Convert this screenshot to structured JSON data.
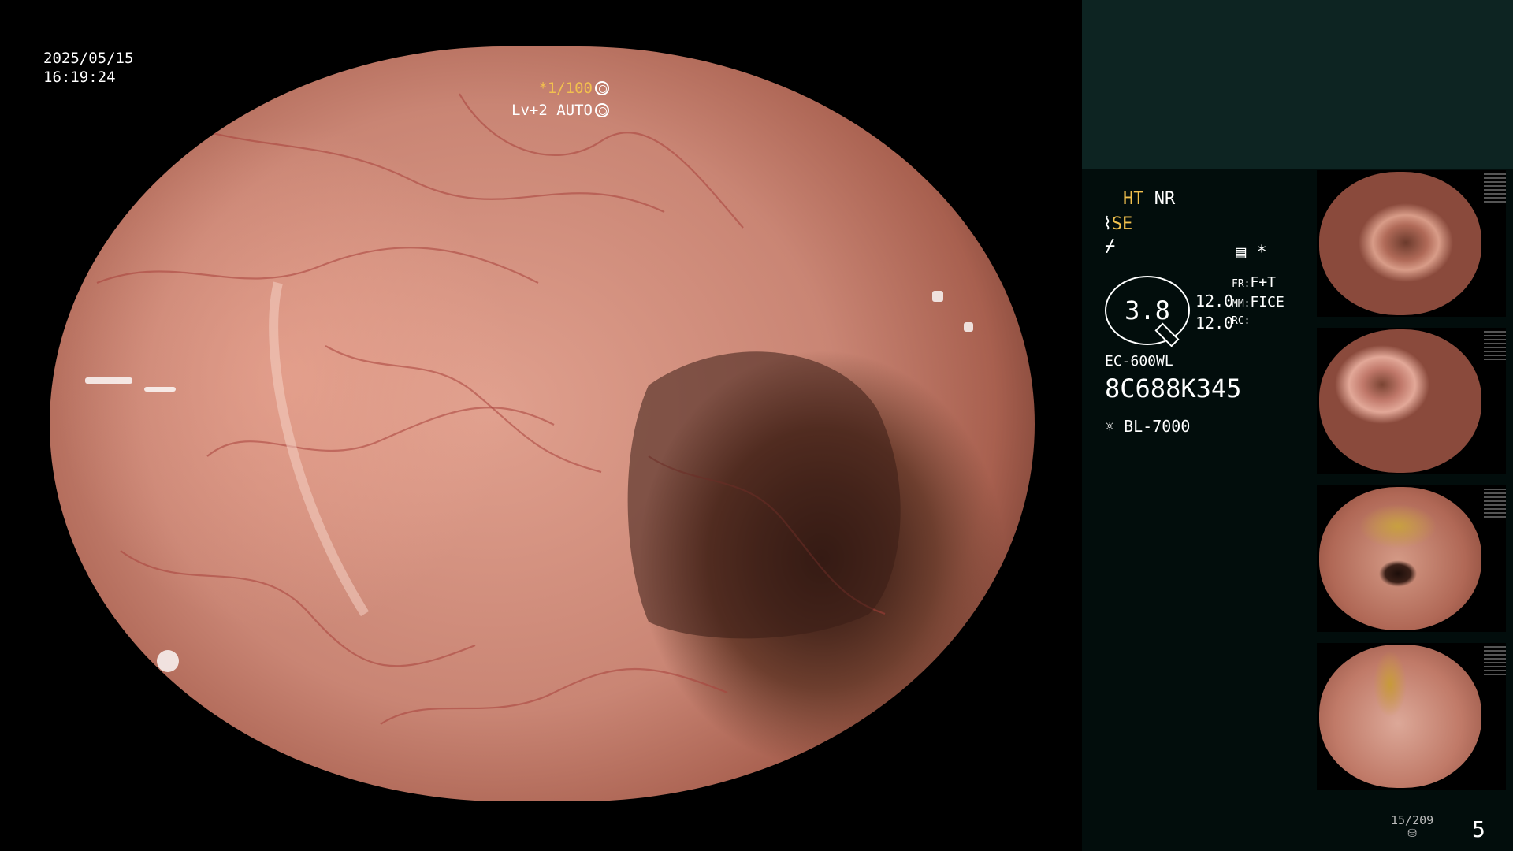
{
  "overlay": {
    "date": "2025/05/15",
    "time": "16:19:24",
    "shutter": "*1/100",
    "level": "Lv+2 AUTO"
  },
  "sidebar": {
    "ht": "HT",
    "nr": "NR",
    "se": "SE",
    "pressure_value": "3.8",
    "setting_a": "12.0",
    "setting_b": "12.0",
    "fr_label": "FR:",
    "fr_value": "F+T",
    "mm_label": "MM:",
    "mm_value": "FICE",
    "rc_label": "RC:",
    "scope_model": "EC-600WL",
    "serial": "8C688K345",
    "light_source": "BL-7000",
    "asterisk": "*"
  },
  "footer": {
    "counter": "15/209",
    "page": "5"
  },
  "colors": {
    "accent_yellow": "#f2c14e",
    "panel_teal": "#0d2422",
    "sidebar_bg": "#020d0c"
  },
  "icons": [
    "shutter-icon",
    "auto-iris-icon",
    "enhance-icon",
    "monitor-icon",
    "light-source-icon",
    "storage-icon"
  ]
}
